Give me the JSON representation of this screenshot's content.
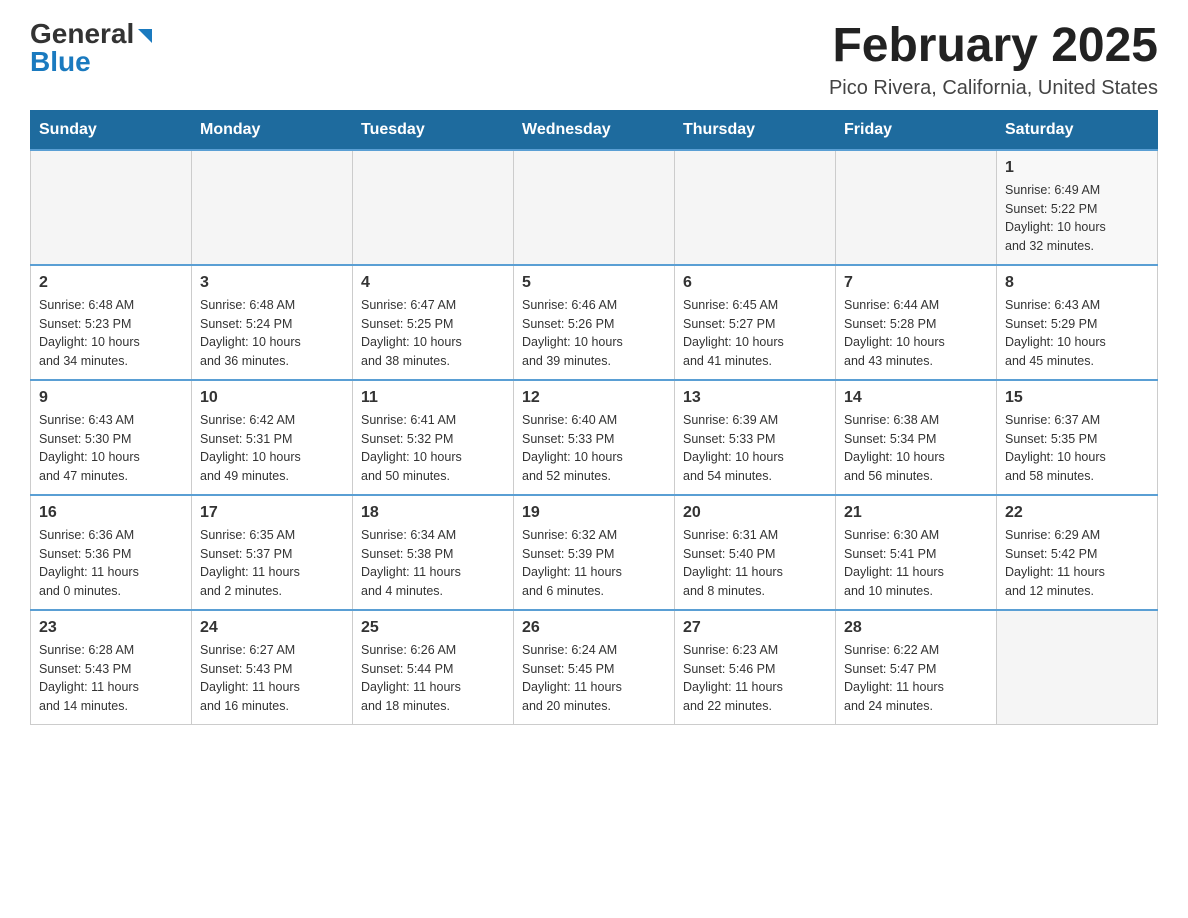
{
  "logo": {
    "general": "General",
    "blue": "Blue"
  },
  "title": "February 2025",
  "subtitle": "Pico Rivera, California, United States",
  "days_of_week": [
    "Sunday",
    "Monday",
    "Tuesday",
    "Wednesday",
    "Thursday",
    "Friday",
    "Saturday"
  ],
  "weeks": [
    [
      {
        "day": "",
        "info": ""
      },
      {
        "day": "",
        "info": ""
      },
      {
        "day": "",
        "info": ""
      },
      {
        "day": "",
        "info": ""
      },
      {
        "day": "",
        "info": ""
      },
      {
        "day": "",
        "info": ""
      },
      {
        "day": "1",
        "info": "Sunrise: 6:49 AM\nSunset: 5:22 PM\nDaylight: 10 hours\nand 32 minutes."
      }
    ],
    [
      {
        "day": "2",
        "info": "Sunrise: 6:48 AM\nSunset: 5:23 PM\nDaylight: 10 hours\nand 34 minutes."
      },
      {
        "day": "3",
        "info": "Sunrise: 6:48 AM\nSunset: 5:24 PM\nDaylight: 10 hours\nand 36 minutes."
      },
      {
        "day": "4",
        "info": "Sunrise: 6:47 AM\nSunset: 5:25 PM\nDaylight: 10 hours\nand 38 minutes."
      },
      {
        "day": "5",
        "info": "Sunrise: 6:46 AM\nSunset: 5:26 PM\nDaylight: 10 hours\nand 39 minutes."
      },
      {
        "day": "6",
        "info": "Sunrise: 6:45 AM\nSunset: 5:27 PM\nDaylight: 10 hours\nand 41 minutes."
      },
      {
        "day": "7",
        "info": "Sunrise: 6:44 AM\nSunset: 5:28 PM\nDaylight: 10 hours\nand 43 minutes."
      },
      {
        "day": "8",
        "info": "Sunrise: 6:43 AM\nSunset: 5:29 PM\nDaylight: 10 hours\nand 45 minutes."
      }
    ],
    [
      {
        "day": "9",
        "info": "Sunrise: 6:43 AM\nSunset: 5:30 PM\nDaylight: 10 hours\nand 47 minutes."
      },
      {
        "day": "10",
        "info": "Sunrise: 6:42 AM\nSunset: 5:31 PM\nDaylight: 10 hours\nand 49 minutes."
      },
      {
        "day": "11",
        "info": "Sunrise: 6:41 AM\nSunset: 5:32 PM\nDaylight: 10 hours\nand 50 minutes."
      },
      {
        "day": "12",
        "info": "Sunrise: 6:40 AM\nSunset: 5:33 PM\nDaylight: 10 hours\nand 52 minutes."
      },
      {
        "day": "13",
        "info": "Sunrise: 6:39 AM\nSunset: 5:33 PM\nDaylight: 10 hours\nand 54 minutes."
      },
      {
        "day": "14",
        "info": "Sunrise: 6:38 AM\nSunset: 5:34 PM\nDaylight: 10 hours\nand 56 minutes."
      },
      {
        "day": "15",
        "info": "Sunrise: 6:37 AM\nSunset: 5:35 PM\nDaylight: 10 hours\nand 58 minutes."
      }
    ],
    [
      {
        "day": "16",
        "info": "Sunrise: 6:36 AM\nSunset: 5:36 PM\nDaylight: 11 hours\nand 0 minutes."
      },
      {
        "day": "17",
        "info": "Sunrise: 6:35 AM\nSunset: 5:37 PM\nDaylight: 11 hours\nand 2 minutes."
      },
      {
        "day": "18",
        "info": "Sunrise: 6:34 AM\nSunset: 5:38 PM\nDaylight: 11 hours\nand 4 minutes."
      },
      {
        "day": "19",
        "info": "Sunrise: 6:32 AM\nSunset: 5:39 PM\nDaylight: 11 hours\nand 6 minutes."
      },
      {
        "day": "20",
        "info": "Sunrise: 6:31 AM\nSunset: 5:40 PM\nDaylight: 11 hours\nand 8 minutes."
      },
      {
        "day": "21",
        "info": "Sunrise: 6:30 AM\nSunset: 5:41 PM\nDaylight: 11 hours\nand 10 minutes."
      },
      {
        "day": "22",
        "info": "Sunrise: 6:29 AM\nSunset: 5:42 PM\nDaylight: 11 hours\nand 12 minutes."
      }
    ],
    [
      {
        "day": "23",
        "info": "Sunrise: 6:28 AM\nSunset: 5:43 PM\nDaylight: 11 hours\nand 14 minutes."
      },
      {
        "day": "24",
        "info": "Sunrise: 6:27 AM\nSunset: 5:43 PM\nDaylight: 11 hours\nand 16 minutes."
      },
      {
        "day": "25",
        "info": "Sunrise: 6:26 AM\nSunset: 5:44 PM\nDaylight: 11 hours\nand 18 minutes."
      },
      {
        "day": "26",
        "info": "Sunrise: 6:24 AM\nSunset: 5:45 PM\nDaylight: 11 hours\nand 20 minutes."
      },
      {
        "day": "27",
        "info": "Sunrise: 6:23 AM\nSunset: 5:46 PM\nDaylight: 11 hours\nand 22 minutes."
      },
      {
        "day": "28",
        "info": "Sunrise: 6:22 AM\nSunset: 5:47 PM\nDaylight: 11 hours\nand 24 minutes."
      },
      {
        "day": "",
        "info": ""
      }
    ]
  ]
}
